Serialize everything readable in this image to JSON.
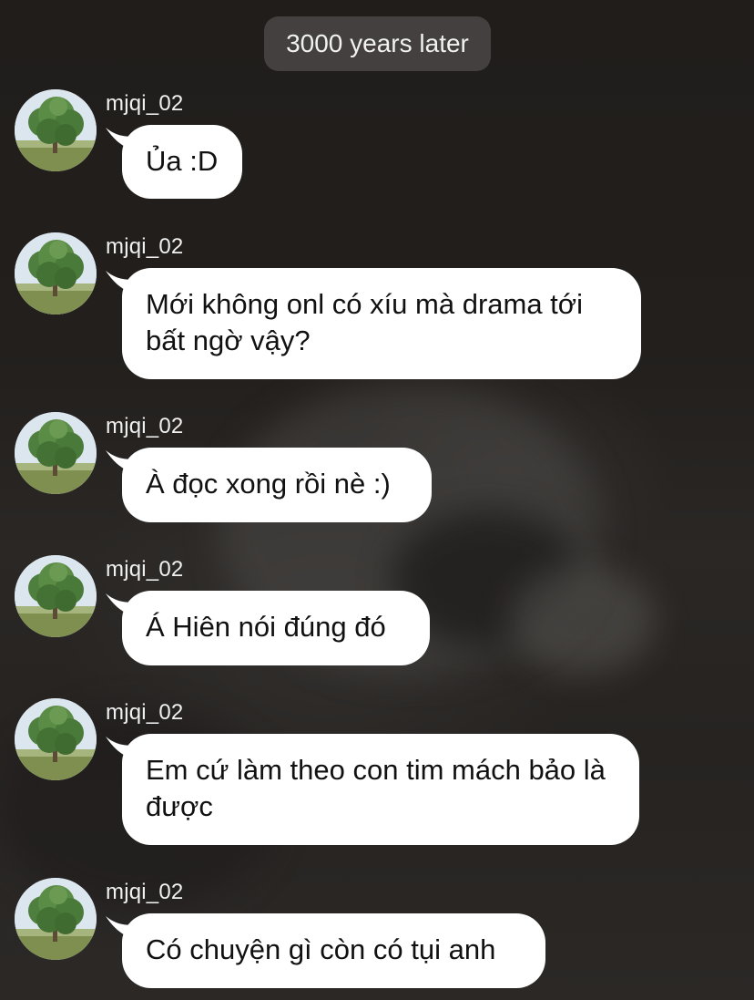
{
  "chat": {
    "time_separator": "3000 years later",
    "messages": [
      {
        "username": "mjqi_02",
        "text": "Ủa :D",
        "avatar_icon": "tree-avatar"
      },
      {
        "username": "mjqi_02",
        "text": "Mới không onl có xíu mà drama tới bất ngờ vậy?",
        "avatar_icon": "tree-avatar"
      },
      {
        "username": "mjqi_02",
        "text": "À đọc xong rồi nè :)",
        "avatar_icon": "tree-avatar"
      },
      {
        "username": "mjqi_02",
        "text": "Á Hiên nói đúng đó",
        "avatar_icon": "tree-avatar"
      },
      {
        "username": "mjqi_02",
        "text": "Em cứ làm theo con tim mách bảo là được",
        "avatar_icon": "tree-avatar"
      },
      {
        "username": "mjqi_02",
        "text": "Có chuyện gì còn có tụi anh",
        "avatar_icon": "tree-avatar"
      }
    ]
  },
  "colors": {
    "background": "#24211f",
    "bubble": "#ffffff",
    "bubble_text": "#111111",
    "username_text": "#f0f0f0",
    "time_pill": "#484644"
  }
}
